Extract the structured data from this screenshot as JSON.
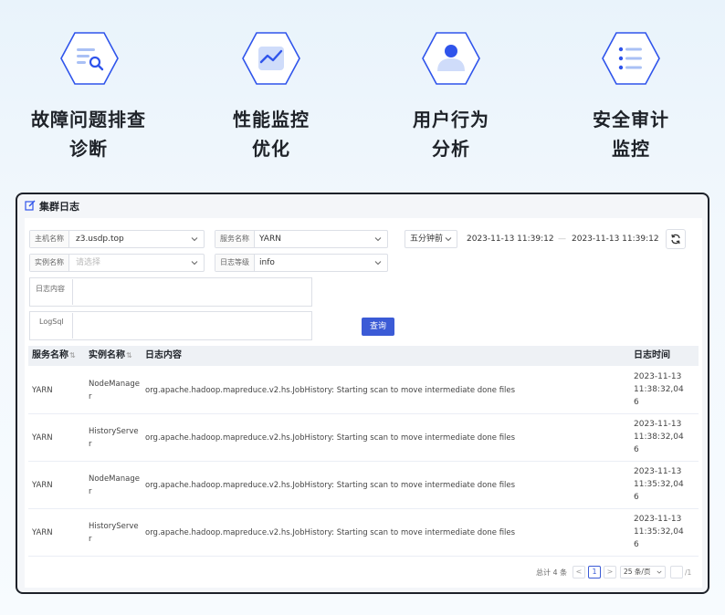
{
  "features": [
    {
      "icon": "log-search-icon",
      "label_line1": "故障问题排查",
      "label_line2": "诊断"
    },
    {
      "icon": "trend-chart-icon",
      "label_line1": "性能监控",
      "label_line2": "优化"
    },
    {
      "icon": "user-icon",
      "label_line1": "用户行为",
      "label_line2": "分析"
    },
    {
      "icon": "list-icon",
      "label_line1": "安全审计",
      "label_line2": "监控"
    }
  ],
  "panel": {
    "title": "集群日志"
  },
  "filters": {
    "host_label": "主机名称",
    "host_value": "z3.usdp.top",
    "service_label": "服务名称",
    "service_value": "YARN",
    "instance_label": "实例名称",
    "instance_placeholder": "请选择",
    "level_label": "日志等级",
    "level_value": "info",
    "content_label": "日志内容",
    "logsql_label": "LogSql",
    "time_range": "五分钟前",
    "start_time": "2023-11-13 11:39:12",
    "separator": "—",
    "end_time": "2023-11-13 11:39:12",
    "query_label": "查询"
  },
  "table": {
    "headers": {
      "service": "服务名称",
      "instance": "实例名称",
      "content": "日志内容",
      "time": "日志时间"
    },
    "rows": [
      {
        "service": "YARN",
        "instance": "NodeManager",
        "content": "org.apache.hadoop.mapreduce.v2.hs.JobHistory: Starting scan to move intermediate done files",
        "time": "2023-11-13 11:38:32,046"
      },
      {
        "service": "YARN",
        "instance": "HistoryServer",
        "content": "org.apache.hadoop.mapreduce.v2.hs.JobHistory: Starting scan to move intermediate done files",
        "time": "2023-11-13 11:38:32,046"
      },
      {
        "service": "YARN",
        "instance": "NodeManager",
        "content": "org.apache.hadoop.mapreduce.v2.hs.JobHistory: Starting scan to move intermediate done files",
        "time": "2023-11-13 11:35:32,046"
      },
      {
        "service": "YARN",
        "instance": "HistoryServer",
        "content": "org.apache.hadoop.mapreduce.v2.hs.JobHistory: Starting scan to move intermediate done files",
        "time": "2023-11-13 11:35:32,046"
      }
    ]
  },
  "pagination": {
    "total": "总计 4 条",
    "prev": "<",
    "page": "1",
    "next": ">",
    "page_size": "25 条/页",
    "jump_suffix": "/1"
  },
  "colors": {
    "accent": "#3b5bd6",
    "hex_border": "#2f54eb"
  }
}
